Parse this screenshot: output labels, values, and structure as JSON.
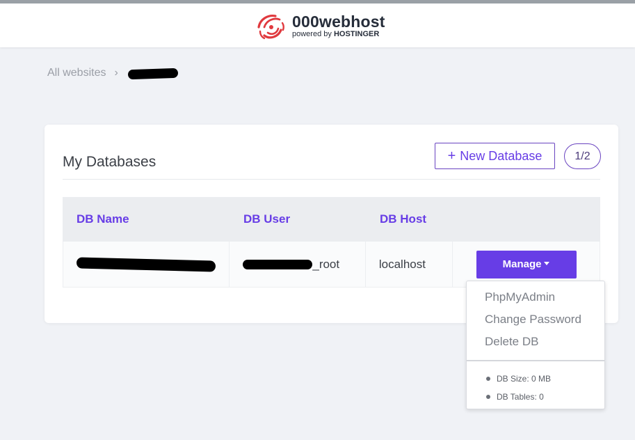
{
  "header": {
    "logo_title": "000webhost",
    "logo_powered": "powered by",
    "logo_brand": "HOSTINGER"
  },
  "breadcrumb": {
    "root": "All websites",
    "separator": "›"
  },
  "card": {
    "title": "My Databases",
    "new_db_label": "New Database",
    "new_db_icon": "+",
    "count": "1/2"
  },
  "table": {
    "headers": [
      "DB Name",
      "DB User",
      "DB Host",
      ""
    ],
    "rows": [
      {
        "db_user_suffix": "_root",
        "db_host": "localhost",
        "action_label": "Manage"
      }
    ]
  },
  "dropdown": {
    "items": [
      "PhpMyAdmin",
      "Change Password",
      "Delete DB"
    ],
    "info": [
      "DB Size: 0 MB",
      "DB Tables: 0"
    ]
  },
  "colors": {
    "accent": "#673de6",
    "background": "#f0f2f6",
    "logo_red": "#e0393e"
  }
}
